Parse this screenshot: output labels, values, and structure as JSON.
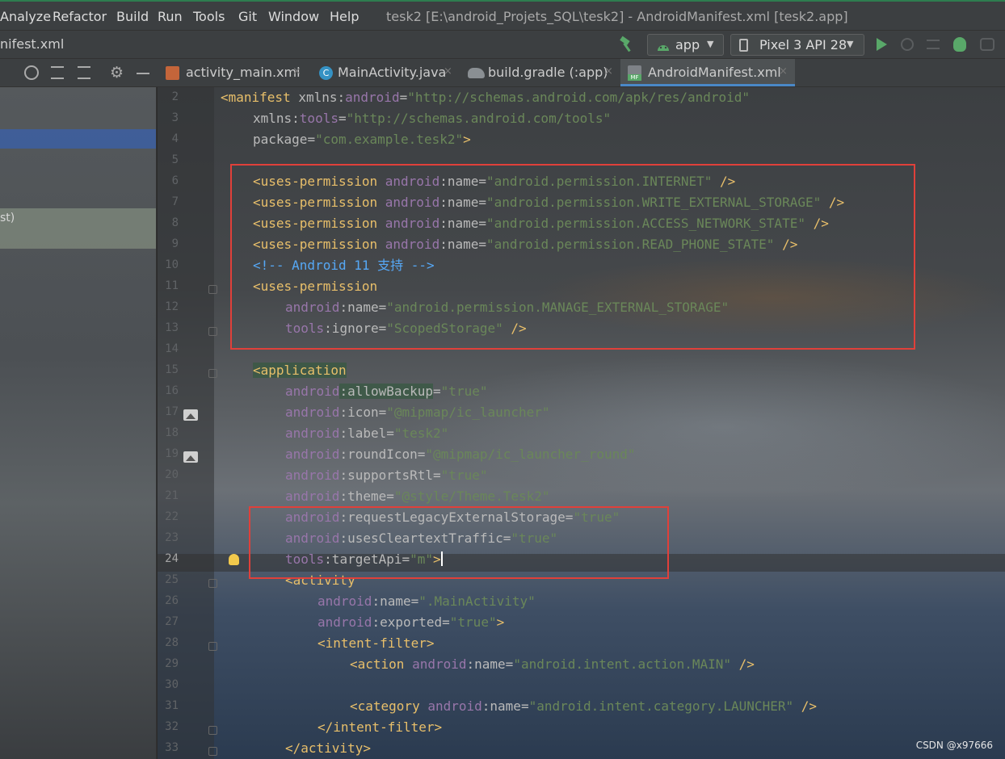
{
  "menu": [
    {
      "label": "Analyze"
    },
    {
      "label": "Refactor"
    },
    {
      "label": "Build"
    },
    {
      "label": "Run"
    },
    {
      "label": "Tools"
    },
    {
      "label": "Git"
    },
    {
      "label": "Window"
    },
    {
      "label": "Help"
    }
  ],
  "window_title": "tesk2 [E:\\android_Projets_SQL\\tesk2] - AndroidManifest.xml [tesk2.app]",
  "navbar": {
    "breadcrumb": "nifest.xml",
    "run_config": "app",
    "device": "Pixel 3 API 28"
  },
  "side_panel": {
    "partial_text": "st)"
  },
  "tabs": [
    {
      "label": "activity_main.xml",
      "close": "×"
    },
    {
      "label": "MainActivity.java",
      "close": "×"
    },
    {
      "label": "build.gradle (:app)",
      "close": "×"
    },
    {
      "label": "AndroidManifest.xml",
      "close": "×",
      "active": true
    }
  ],
  "line_numbers": [
    "2",
    "3",
    "4",
    "5",
    "6",
    "7",
    "8",
    "9",
    "10",
    "11",
    "12",
    "13",
    "14",
    "15",
    "16",
    "17",
    "18",
    "19",
    "20",
    "21",
    "22",
    "23",
    "24",
    "25",
    "26",
    "27",
    "28",
    "29",
    "30",
    "31",
    "32",
    "33"
  ],
  "code": {
    "l2": {
      "tag": "<manifest",
      "attr": " xmlns:",
      "ns": "android",
      "eq": "=",
      "val": "\"http://schemas.android.com/apk/res/android\""
    },
    "l3": {
      "attr": "xmlns:",
      "ns": "tools",
      "eq": "=",
      "val": "\"http://schemas.android.com/tools\""
    },
    "l4": {
      "attr": "package",
      "eq": "=",
      "val": "\"com.example.tesk2\"",
      "end": ">"
    },
    "l6": {
      "tag": "<uses-permission ",
      "ns": "android",
      "attr": ":name",
      "eq": "=",
      "val": "\"android.permission.INTERNET\"",
      "end": " />"
    },
    "l7": {
      "tag": "<uses-permission ",
      "ns": "android",
      "attr": ":name",
      "eq": "=",
      "val": "\"android.permission.WRITE_EXTERNAL_STORAGE\"",
      "end": " />"
    },
    "l8": {
      "tag": "<uses-permission ",
      "ns": "android",
      "attr": ":name",
      "eq": "=",
      "val": "\"android.permission.ACCESS_NETWORK_STATE\"",
      "end": " />"
    },
    "l9": {
      "tag": "<uses-permission ",
      "ns": "android",
      "attr": ":name",
      "eq": "=",
      "val": "\"android.permission.READ_PHONE_STATE\"",
      "end": " />"
    },
    "l10": {
      "open": "<!--",
      "text": " Android 11 支持 ",
      "close": "-->"
    },
    "l11": {
      "tag": "<uses-permission"
    },
    "l12": {
      "ns": "android",
      "attr": ":name",
      "eq": "=",
      "val": "\"android.permission.MANAGE_EXTERNAL_STORAGE\""
    },
    "l13": {
      "ns": "tools",
      "attr": ":ignore",
      "eq": "=",
      "val": "\"ScopedStorage\"",
      "end": " />"
    },
    "l15": {
      "tag": "<application"
    },
    "l16": {
      "ns": "android",
      "attr": ":allowBackup",
      "eq": "=",
      "val": "\"true\""
    },
    "l17": {
      "ns": "android",
      "attr": ":icon",
      "eq": "=",
      "val": "\"@mipmap/ic_launcher\""
    },
    "l18": {
      "ns": "android",
      "attr": ":label",
      "eq": "=",
      "val": "\"tesk2\""
    },
    "l19": {
      "ns": "android",
      "attr": ":roundIcon",
      "eq": "=",
      "val": "\"@mipmap/ic_launcher_round\""
    },
    "l20": {
      "ns": "android",
      "attr": ":supportsRtl",
      "eq": "=",
      "val": "\"true\""
    },
    "l21": {
      "ns": "android",
      "attr": ":theme",
      "eq": "=",
      "val": "\"@style/Theme.Tesk2\""
    },
    "l22": {
      "ns": "android",
      "attr": ":requestLegacyExternalStorage",
      "eq": "=",
      "val": "\"true\""
    },
    "l23": {
      "ns": "android",
      "attr": ":usesCleartextTraffic",
      "eq": "=",
      "val": "\"true\""
    },
    "l24": {
      "ns": "tools",
      "attr": ":targetApi",
      "eq": "=",
      "val": "\"m\"",
      "end": ">"
    },
    "l25": {
      "tag": "<activity"
    },
    "l26": {
      "ns": "android",
      "attr": ":name",
      "eq": "=",
      "val": "\".MainActivity\""
    },
    "l27": {
      "ns": "android",
      "attr": ":exported",
      "eq": "=",
      "val": "\"true\"",
      "end": ">"
    },
    "l28": {
      "tag": "<intent-filter>"
    },
    "l29": {
      "tag": "<action ",
      "ns": "android",
      "attr": ":name",
      "eq": "=",
      "val": "\"android.intent.action.MAIN\"",
      "end": " />"
    },
    "l31": {
      "tag": "<category ",
      "ns": "android",
      "attr": ":name",
      "eq": "=",
      "val": "\"android.intent.category.LAUNCHER\"",
      "end": " />"
    },
    "l32": {
      "tag": "</intent-filter>"
    },
    "l33": {
      "tag": "</activity>"
    }
  },
  "watermark": "CSDN @x97666",
  "colors": {
    "accent_tab_underline": "#4a88c7",
    "highlight_box": "#e0403a",
    "run_green": "#59a869"
  },
  "icons": [
    "build-hammer-icon",
    "android-icon",
    "device-icon",
    "run-icon",
    "rerun-icon",
    "coverage-icon",
    "debug-icon",
    "profile-icon",
    "locate-icon",
    "expand-icon",
    "collapse-icon",
    "gear-icon",
    "hide-icon",
    "bulb-icon",
    "image-icon"
  ]
}
